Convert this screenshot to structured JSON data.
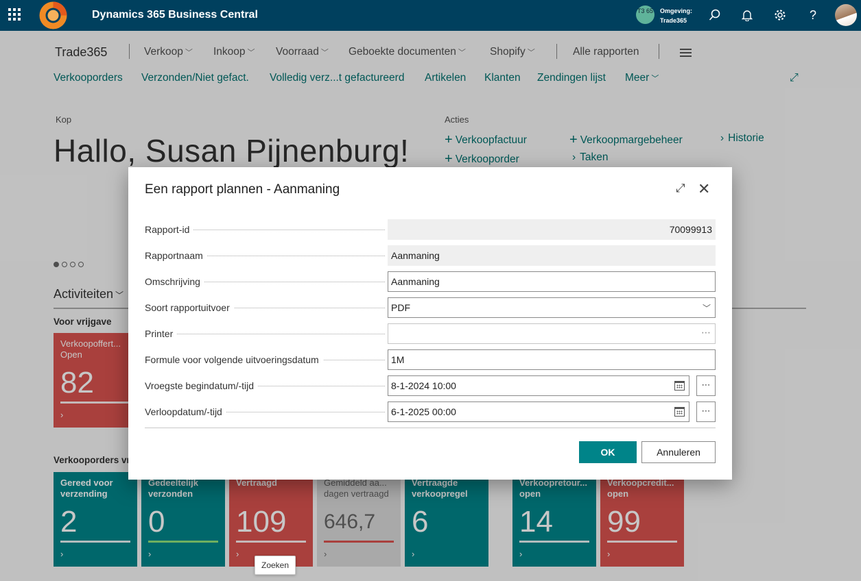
{
  "topbar": {
    "app_name": "Dynamics 365 Business Central",
    "env_badge": "T3 65",
    "env_label_line1": "Omgeving:",
    "env_label_line2": "Trade365"
  },
  "nav": {
    "company": "Trade365",
    "menus": [
      "Verkoop",
      "Inkoop",
      "Voorraad",
      "Geboekte documenten",
      "Shopify"
    ],
    "all_reports": "Alle rapporten",
    "links": [
      "Verkooporders",
      "Verzonden/Niet gefact.",
      "Volledig verz...t gefactureerd",
      "Artikelen",
      "Klanten",
      "Zendingen lijst",
      "Meer"
    ]
  },
  "headline": {
    "caption": "Kop",
    "greeting": "Hallo, Susan Pijnenburg!"
  },
  "actions": {
    "caption": "Acties",
    "items": [
      "Verkoopfactuur",
      "Verkoopmargebeheer",
      "Historie",
      "Verkooporder",
      "Taken"
    ]
  },
  "activities": {
    "title": "Activiteiten",
    "group1": "Voor vrijgave",
    "group2": "Verkooporders vr",
    "tiles": [
      {
        "label": "Verkoopoffert... Open",
        "value": "82"
      },
      {
        "label": "Gereed voor verzending",
        "value": "2"
      },
      {
        "label": "Gedeeltelijk verzonden",
        "value": "0"
      },
      {
        "label": "Vertraagd",
        "value": "109"
      },
      {
        "label": "Gemiddeld aa... dagen vertraagd",
        "value": "646,7"
      },
      {
        "label": "Vertraagde verkoopregel",
        "value": "6"
      },
      {
        "label": "Verkoopretour... open",
        "value": "14"
      },
      {
        "label": "Verkoopcredit... open",
        "value": "99"
      }
    ]
  },
  "tooltip": "Zoeken",
  "dialog": {
    "title": "Een rapport plannen - Aanmaning",
    "fields": [
      {
        "label": "Rapport-id",
        "value": "70099913"
      },
      {
        "label": "Rapportnaam",
        "value": "Aanmaning"
      },
      {
        "label": "Omschrijving",
        "value": "Aanmaning"
      },
      {
        "label": "Soort rapportuitvoer",
        "value": "PDF"
      },
      {
        "label": "Printer",
        "value": ""
      },
      {
        "label": "Formule voor volgende uitvoeringsdatum",
        "value": "1M"
      },
      {
        "label": "Vroegste begindatum/-tijd",
        "value": "8-1-2024 10:00"
      },
      {
        "label": "Verloopdatum/-tijd",
        "value": "6-1-2025 00:00"
      }
    ],
    "ok_label": "OK",
    "cancel_label": "Annuleren"
  },
  "colors": {
    "topbar": "#00405e",
    "accent": "#008489",
    "tile_red": "#d9534f",
    "link": "#00706e"
  }
}
